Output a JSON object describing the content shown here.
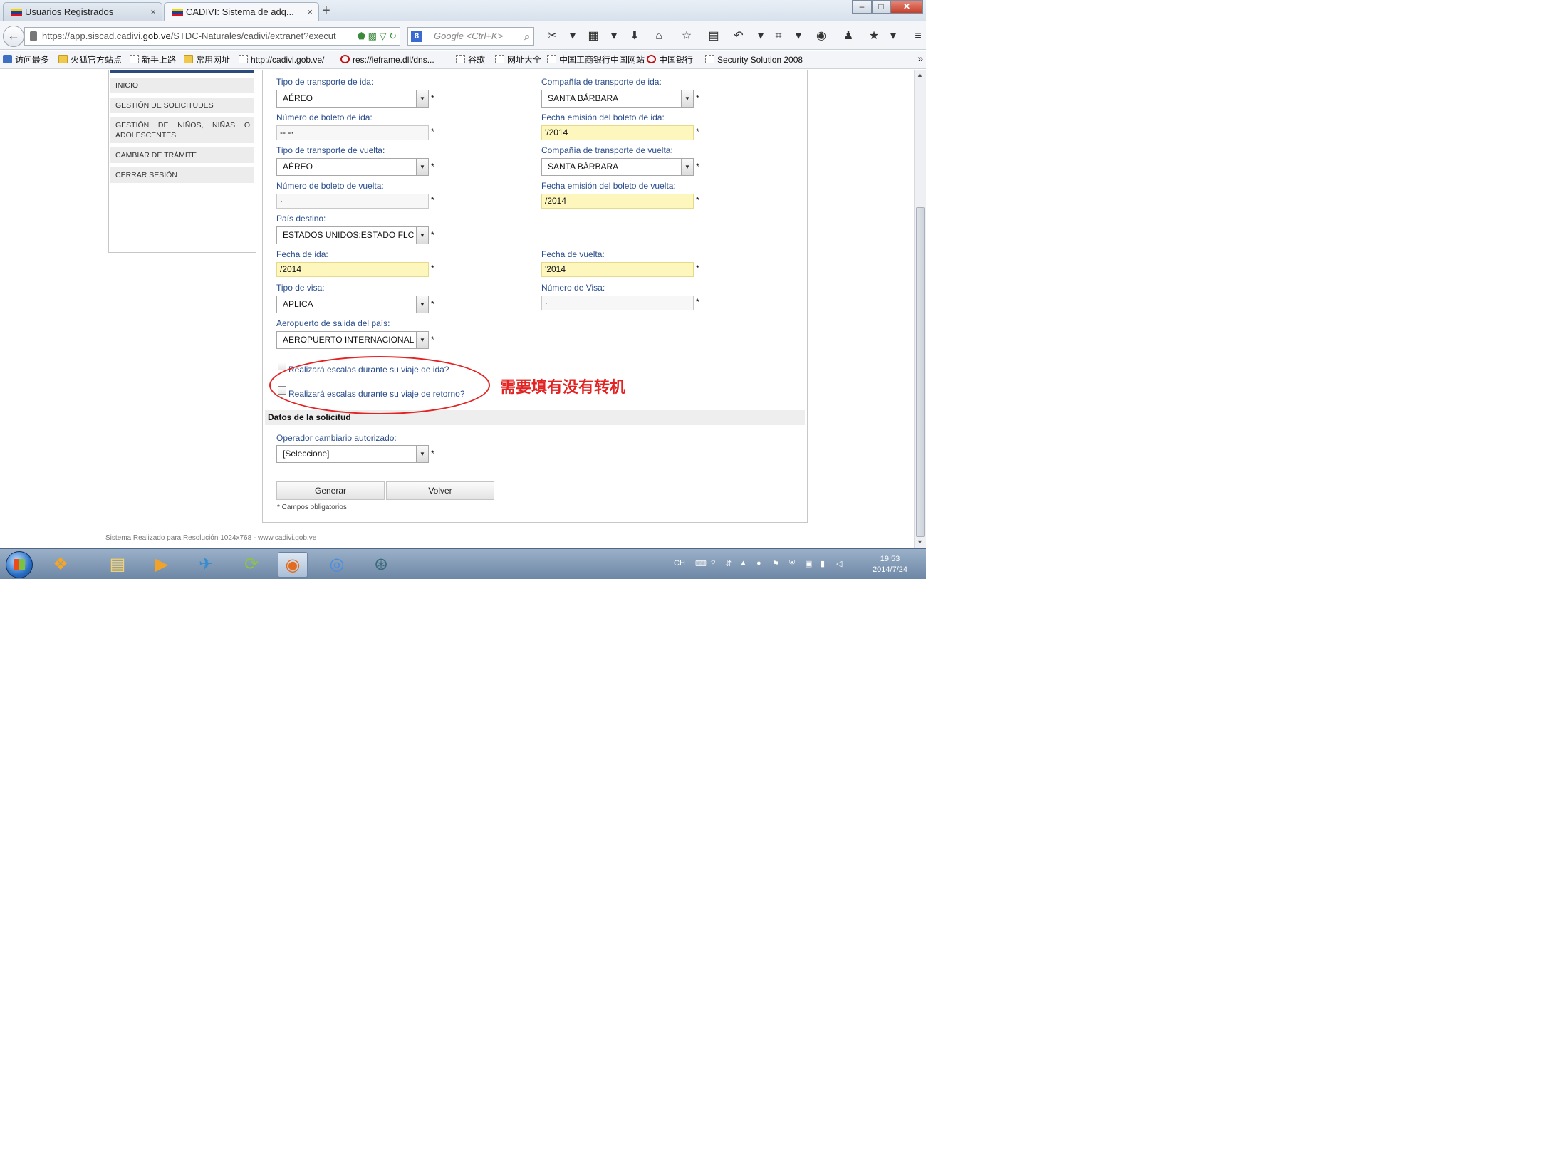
{
  "browser": {
    "tabs": [
      {
        "title": "Usuarios Registrados",
        "close": "×"
      },
      {
        "title": "CADIVI: Sistema de adq...",
        "close": "×"
      }
    ],
    "new_tab": "+",
    "window_buttons": {
      "minimize": "–",
      "maximize": "□",
      "close": "✕"
    },
    "back": "←",
    "url_prefix": "https://app.siscad.cadivi.",
    "url_domain": "gob.ve",
    "url_suffix": "/STDC-Naturales/cadivi/extranet?execut",
    "url_tools": "⬟ ▩ ▽ ↻",
    "search_engine": "8",
    "search_placeholder": "Google <Ctrl+K>",
    "search_glass": "⌕",
    "toolbar_icons": [
      {
        "name": "screenshot-icon",
        "glyph": "✂"
      },
      {
        "name": "chevron-down-icon",
        "glyph": "▾"
      },
      {
        "name": "apps-icon",
        "glyph": "▦"
      },
      {
        "name": "chevron-down-icon-2",
        "glyph": "▾"
      },
      {
        "name": "download-icon",
        "glyph": "⬇"
      },
      {
        "name": "home-icon",
        "glyph": "⌂"
      },
      {
        "name": "star-icon",
        "glyph": "☆"
      },
      {
        "name": "clipboard-icon",
        "glyph": "▤"
      },
      {
        "name": "undo-icon",
        "glyph": "↶"
      },
      {
        "name": "chevron-down-icon-3",
        "glyph": "▾"
      },
      {
        "name": "crop-icon",
        "glyph": "⌗"
      },
      {
        "name": "chevron-down-icon-4",
        "glyph": "▾"
      },
      {
        "name": "chat-icon",
        "glyph": "◉"
      },
      {
        "name": "user-icon",
        "glyph": "♟"
      },
      {
        "name": "favorite-badge-icon",
        "glyph": "★"
      },
      {
        "name": "chevron-down-icon-5",
        "glyph": "▾"
      },
      {
        "name": "menu-icon",
        "glyph": "≡"
      }
    ],
    "bookmarks": [
      {
        "label": "访问最多",
        "icon": "blue"
      },
      {
        "label": "火狐官方站点",
        "icon": "folder"
      },
      {
        "label": "新手上路",
        "icon": "page"
      },
      {
        "label": "常用网址",
        "icon": "folder"
      },
      {
        "label": "http://cadivi.gob.ve/",
        "icon": "page"
      },
      {
        "label": "res://ieframe.dll/dns...",
        "icon": "red"
      },
      {
        "label": "谷歌",
        "icon": "page"
      },
      {
        "label": "网址大全",
        "icon": "page"
      },
      {
        "label": "中国工商银行中国网站",
        "icon": "page"
      },
      {
        "label": "中国银行",
        "icon": "red"
      },
      {
        "label": "Security Solution 2008",
        "icon": "page"
      }
    ],
    "bookmarks_more": "»"
  },
  "sidebar": {
    "items": [
      "INICIO",
      "GESTIÓN DE SOLICITUDES",
      "GESTIÓN DE NIÑOS, NIÑAS O ADOLESCENTES",
      "CAMBIAR DE TRÁMITE",
      "CERRAR SESIÓN"
    ]
  },
  "form": {
    "tipo_ida": {
      "label": "Tipo de transporte de ida:",
      "value": "AÉREO"
    },
    "compania_ida": {
      "label": "Compañía de transporte de ida:",
      "value": "SANTA BÁRBARA"
    },
    "numero_ida": {
      "label": "Número de boleto de ida:",
      "value": "-- -·"
    },
    "fecha_emision_ida": {
      "label": "Fecha emisión del boleto de ida:",
      "value": "'/2014"
    },
    "tipo_vuelta": {
      "label": "Tipo de transporte de vuelta:",
      "value": "AÉREO"
    },
    "compania_vuelta": {
      "label": "Compañía de transporte de vuelta:",
      "value": "SANTA BÁRBARA"
    },
    "numero_vuelta": {
      "label": "Número de boleto de vuelta:",
      "value": "·"
    },
    "fecha_emision_vuelta": {
      "label": "Fecha emisión del boleto de vuelta:",
      "value": "/2014"
    },
    "pais": {
      "label": "País destino:",
      "value": "ESTADOS UNIDOS:ESTADO FLC"
    },
    "fecha_ida": {
      "label": "Fecha de ida:",
      "value": "/2014"
    },
    "fecha_vuelta": {
      "label": "Fecha de vuelta:",
      "value": "'2014"
    },
    "tipo_visa": {
      "label": "Tipo de visa:",
      "value": "APLICA"
    },
    "numero_visa": {
      "label": "Número de Visa:",
      "value": "·"
    },
    "aeropuerto": {
      "label": "Aeropuerto de salida del país:",
      "value": "AEROPUERTO INTERNACIONAL"
    },
    "escala_ida": "Realizará escalas durante su viaje de ida?",
    "escala_retorno": "Realizará escalas durante su viaje de retorno?",
    "required_mark": "*",
    "section_title": "Datos de la solicitud",
    "operador": {
      "label": "Operador cambiario autorizado:",
      "value": "[Seleccione]"
    },
    "generar": "Generar",
    "volver": "Volver",
    "required_note": "* Campos obligatorios",
    "dropdown_arrow": "▼"
  },
  "footer": "Sistema Realizado para Resolución 1024x768 - www.cadivi.gob.ve",
  "annotation": {
    "text": "需要填有没有转机",
    "color": "#e32222"
  },
  "scrollbar": {
    "up": "▲",
    "down": "▼"
  },
  "taskbar": {
    "apps": [
      {
        "name": "start-button",
        "glyph": ""
      },
      {
        "name": "media-center-icon",
        "glyph": "❖"
      },
      {
        "name": "explorer-folder-icon",
        "glyph": "▤"
      },
      {
        "name": "media-player-icon",
        "glyph": "▶"
      },
      {
        "name": "bird-app-icon",
        "glyph": "✈"
      },
      {
        "name": "green-app-icon",
        "glyph": "⟳"
      },
      {
        "name": "firefox-icon",
        "glyph": "◉"
      },
      {
        "name": "chrome-icon",
        "glyph": "◎"
      },
      {
        "name": "network-app-icon",
        "glyph": "⊛"
      }
    ],
    "tray_lang": "CH",
    "tray_icons": [
      "⌨",
      "?",
      "⇵",
      "▲",
      "●",
      "⚑",
      "⛨",
      "▣",
      "▮",
      "◁"
    ],
    "time": "19:53",
    "date": "2014/7/24"
  },
  "colors": {
    "accent_label": "#2b4e8c",
    "sidebar_bar": "#2b4a7e",
    "highlight_field": "#fdf7be",
    "annotation_red": "#e32222"
  }
}
